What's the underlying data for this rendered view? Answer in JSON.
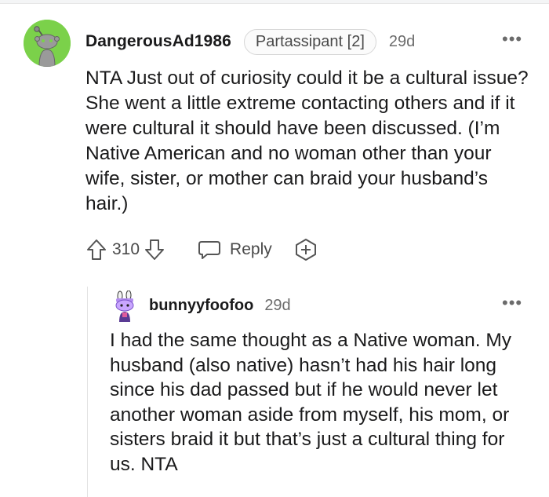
{
  "comment": {
    "username": "DangerousAd1986",
    "flair": "Partassipant [2]",
    "age": "29d",
    "more": "•••",
    "body": "NTA Just out of curiosity could it be a cultural issue? She went a little extreme contacting others and if it were cultural it should have been discussed. (I’m Native American and no woman other than your wife, sister, or mother can braid your husband’s hair.)",
    "score": "310",
    "reply_label": "Reply",
    "icons": {
      "avatar": "snoo-avatar",
      "upvote": "upvote-arrow-icon",
      "downvote": "downvote-arrow-icon",
      "reply": "speech-bubble-icon",
      "award": "award-plus-icon",
      "more": "more-options-icon"
    },
    "colors": {
      "avatar_bg": "#7bd14a"
    }
  },
  "reply": {
    "username": "bunnyyfoofoo",
    "age": "29d",
    "more": "•••",
    "body": "I had the same thought as a Native woman. My husband (also native) hasn’t had his hair long since his dad passed but if he would never let another woman aside from myself, his mom, or sisters braid it but that’s just a cultural thing for us. NTA"
  }
}
